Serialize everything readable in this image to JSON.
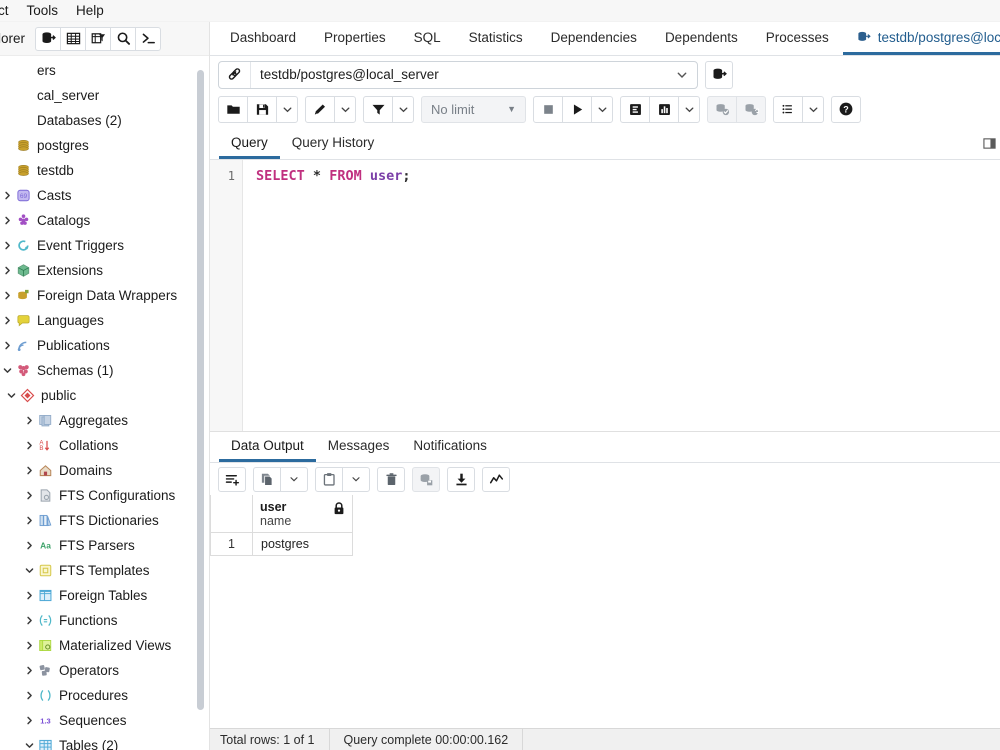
{
  "menubar": {
    "items": [
      {
        "label": "ct",
        "name": "menu-object-clipped"
      },
      {
        "label": "Tools",
        "name": "menu-tools"
      },
      {
        "label": "Help",
        "name": "menu-help"
      }
    ]
  },
  "explorer": {
    "title": "lorer",
    "tools": [
      {
        "name": "server-icon",
        "title": "Server"
      },
      {
        "name": "table-grid-icon",
        "title": "Table"
      },
      {
        "name": "filter-table-icon",
        "title": "Filtered Rows"
      },
      {
        "name": "search-icon",
        "title": "Search"
      },
      {
        "name": "terminal-icon",
        "title": "PSQL Tool"
      }
    ],
    "tree": [
      {
        "label": "ers",
        "indent": 0,
        "chevron": "",
        "icon": "none",
        "color": ""
      },
      {
        "label": "cal_server",
        "indent": 0,
        "chevron": "",
        "icon": "none",
        "color": ""
      },
      {
        "label": "Databases (2)",
        "indent": 0,
        "chevron": "",
        "icon": "none",
        "color": ""
      },
      {
        "label": "postgres",
        "indent": 0,
        "chevron": "",
        "icon": "database",
        "color": "#c8a02c"
      },
      {
        "label": "testdb",
        "indent": 0,
        "chevron": "",
        "icon": "database",
        "color": "#c8a02c"
      },
      {
        "label": "Casts",
        "indent": 0,
        "chevron": "right",
        "icon": "casts",
        "color": "#7b68d6"
      },
      {
        "label": "Catalogs",
        "indent": 0,
        "chevron": "right",
        "icon": "catalogs",
        "color": "#a24fc4"
      },
      {
        "label": "Event Triggers",
        "indent": 0,
        "chevron": "right",
        "icon": "eventtrigger",
        "color": "#4fb8c9"
      },
      {
        "label": "Extensions",
        "indent": 0,
        "chevron": "right",
        "icon": "extension",
        "color": "#3ea36a"
      },
      {
        "label": "Foreign Data Wrappers",
        "indent": 0,
        "chevron": "right",
        "icon": "fdw",
        "color": "#c8a02c"
      },
      {
        "label": "Languages",
        "indent": 0,
        "chevron": "right",
        "icon": "language",
        "color": "#e4d23a"
      },
      {
        "label": "Publications",
        "indent": 0,
        "chevron": "right",
        "icon": "publication",
        "color": "#6f9ed1"
      },
      {
        "label": "Schemas (1)",
        "indent": 0,
        "chevron": "down",
        "icon": "schemas",
        "color": "#d35a7a"
      },
      {
        "label": "public",
        "indent": 1,
        "chevron": "down",
        "icon": "schema",
        "color": "#d84b4b"
      },
      {
        "label": "Aggregates",
        "indent": 2,
        "chevron": "right",
        "icon": "aggregate",
        "color": "#8fa9c7"
      },
      {
        "label": "Collations",
        "indent": 2,
        "chevron": "right",
        "icon": "collation",
        "color": "#d84b4b"
      },
      {
        "label": "Domains",
        "indent": 2,
        "chevron": "right",
        "icon": "domain",
        "color": "#b9885c"
      },
      {
        "label": "FTS Configurations",
        "indent": 2,
        "chevron": "right",
        "icon": "ftsconfig",
        "color": "#9aa4ae"
      },
      {
        "label": "FTS Dictionaries",
        "indent": 2,
        "chevron": "right",
        "icon": "ftsdict",
        "color": "#6f9ed1"
      },
      {
        "label": "FTS Parsers",
        "indent": 2,
        "chevron": "right",
        "icon": "ftsparser",
        "color": "#3ea36a"
      },
      {
        "label": "FTS Templates",
        "indent": 2,
        "chevron": "down",
        "icon": "ftstemplate",
        "color": "#d6c84a"
      },
      {
        "label": "Foreign Tables",
        "indent": 2,
        "chevron": "right",
        "icon": "foreigntable",
        "color": "#4fa9d6"
      },
      {
        "label": "Functions",
        "indent": 2,
        "chevron": "right",
        "icon": "function",
        "color": "#4fb8c9"
      },
      {
        "label": "Materialized Views",
        "indent": 2,
        "chevron": "right",
        "icon": "matview",
        "color": "#a8d63a"
      },
      {
        "label": "Operators",
        "indent": 2,
        "chevron": "right",
        "icon": "operator",
        "color": "#8c93a0"
      },
      {
        "label": "Procedures",
        "indent": 2,
        "chevron": "right",
        "icon": "procedure",
        "color": "#4fb8c9"
      },
      {
        "label": "Sequences",
        "indent": 2,
        "chevron": "right",
        "icon": "sequence",
        "color": "#7b4fd6"
      },
      {
        "label": "Tables (2)",
        "indent": 2,
        "chevron": "down",
        "icon": "tables",
        "color": "#4fa9d6"
      }
    ]
  },
  "object_tabs": {
    "items": [
      {
        "label": "Dashboard",
        "active": false,
        "icon": "none"
      },
      {
        "label": "Properties",
        "active": false,
        "icon": "none"
      },
      {
        "label": "SQL",
        "active": false,
        "icon": "none"
      },
      {
        "label": "Statistics",
        "active": false,
        "icon": "none"
      },
      {
        "label": "Dependencies",
        "active": false,
        "icon": "none"
      },
      {
        "label": "Dependents",
        "active": false,
        "icon": "none"
      },
      {
        "label": "Processes",
        "active": false,
        "icon": "none"
      },
      {
        "label": "testdb/postgres@loca",
        "active": true,
        "icon": "query-tool-icon"
      }
    ]
  },
  "connection": {
    "value": "testdb/postgres@local_server",
    "icon": "connection-icon",
    "caret": "chevron-down-icon",
    "side_button": "new-connection-icon"
  },
  "query_toolbar": {
    "open_file": "open-file-icon",
    "save_file": "save-file-icon",
    "save_caret": "chevron-down-icon",
    "edit": "edit-pencil-icon",
    "edit_caret": "chevron-down-icon",
    "filter": "filter-icon",
    "filter_caret": "chevron-down-icon",
    "limit_label": "No limit",
    "stop": "stop-icon",
    "execute": "execute-play-icon",
    "execute_caret": "chevron-down-icon",
    "explain": "explain-icon",
    "explain_analyze": "explain-analyze-icon",
    "explain_caret": "chevron-down-icon",
    "commit": "commit-icon",
    "rollback": "rollback-icon",
    "macros": "macros-list-icon",
    "macros_caret": "chevron-down-icon",
    "help": "help-icon"
  },
  "query_tabs": {
    "items": [
      {
        "label": "Query",
        "active": true
      },
      {
        "label": "Query History",
        "active": false
      }
    ],
    "right_icon": "panel-icon"
  },
  "editor": {
    "line_number": "1",
    "tokens": [
      {
        "text": "SELECT",
        "cls": "kw"
      },
      {
        "text": " ",
        "cls": "op"
      },
      {
        "text": "*",
        "cls": "op"
      },
      {
        "text": " ",
        "cls": "op"
      },
      {
        "text": "FROM",
        "cls": "kw"
      },
      {
        "text": " ",
        "cls": "op"
      },
      {
        "text": "user",
        "cls": "ident"
      },
      {
        "text": ";",
        "cls": "punc"
      }
    ],
    "sql_text": "SELECT * FROM user;"
  },
  "output_tabs": {
    "items": [
      {
        "label": "Data Output",
        "active": true
      },
      {
        "label": "Messages",
        "active": false
      },
      {
        "label": "Notifications",
        "active": false
      }
    ]
  },
  "output_toolbar": {
    "add_row": "add-row-icon",
    "copy": "copy-icon",
    "copy_caret": "chevron-down-icon",
    "paste": "paste-icon",
    "paste_caret": "chevron-down-icon",
    "delete": "trash-icon",
    "save_data": "save-data-icon",
    "download": "download-csv-icon",
    "graph": "graph-visualiser-icon"
  },
  "result_grid": {
    "columns": [
      {
        "name": "user",
        "type": "name",
        "locked": true,
        "lock_icon": "lock-icon"
      }
    ],
    "rows": [
      {
        "num": "1",
        "values": [
          "postgres"
        ]
      }
    ]
  },
  "status_bar": {
    "total_rows": "Total rows: 1 of 1",
    "query_complete": "Query complete 00:00:00.162"
  },
  "colors": {
    "accent": "#2c6b9e",
    "tab_active_text": "#225d8e",
    "keyword": "#c0307f",
    "identifier": "#7b3fa8",
    "toolbar_bg": "#ffffff",
    "panel_bg": "#f7f7f7",
    "status_bg": "#f0f0f0"
  }
}
